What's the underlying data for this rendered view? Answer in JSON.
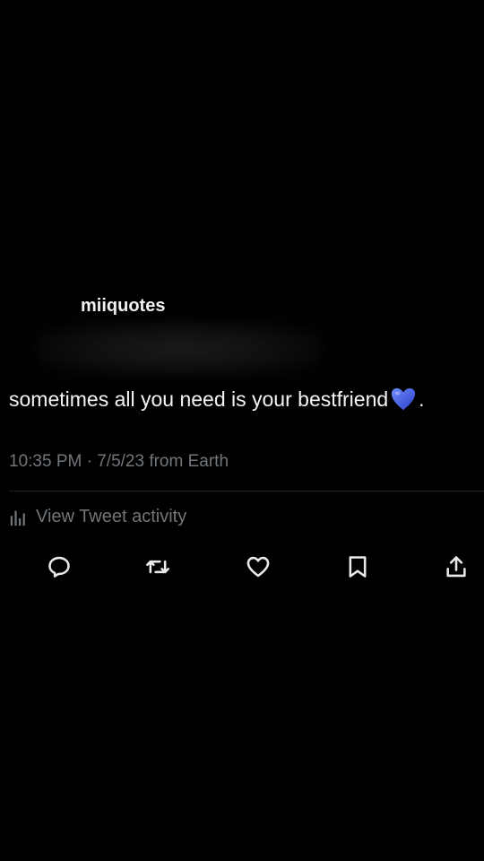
{
  "tweet": {
    "username": "miiquotes",
    "text": "sometimes all you need is your bestfriend",
    "text_end": ".",
    "emoji_icon": "blue-heart-icon",
    "time": "10:35 PM",
    "separator": "·",
    "date": "7/5/23",
    "source": "from Earth"
  },
  "activity": {
    "label": "View Tweet activity",
    "icon": "chart-bars-icon"
  },
  "actions": [
    {
      "name": "reply",
      "icon": "comment-icon"
    },
    {
      "name": "retweet",
      "icon": "retweet-icon"
    },
    {
      "name": "like",
      "icon": "heart-icon"
    },
    {
      "name": "bookmark",
      "icon": "bookmark-icon"
    },
    {
      "name": "share",
      "icon": "share-icon"
    }
  ],
  "colors": {
    "background": "#000000",
    "text": "#f4f4f4",
    "muted": "#71767b",
    "icon": "#e7e9ea",
    "heart_emoji": "#3b5bdb"
  }
}
